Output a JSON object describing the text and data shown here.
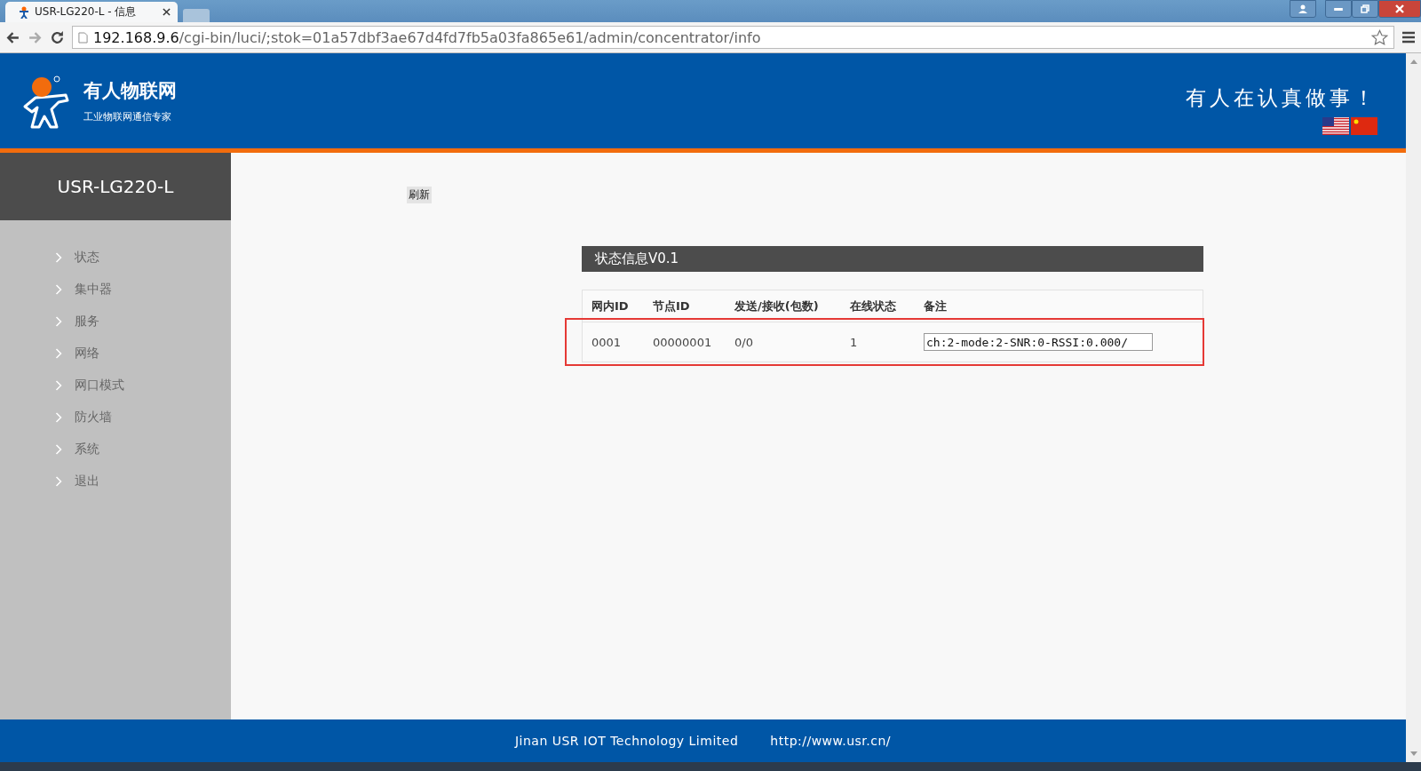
{
  "browser": {
    "tab_title": "USR-LG220-L - 信息",
    "url_host": "192.168.9.6",
    "url_path": "/cgi-bin/luci/;stok=01a57dbf3ae67d4fd7fb5a03fa865e61/admin/concentrator/info"
  },
  "header": {
    "brand": "有人物联网",
    "tagline": "工业物联网通信专家",
    "slogan": "有人在认真做事！"
  },
  "sidebar": {
    "title": "USR-LG220-L",
    "items": [
      {
        "label": "状态",
        "selected": false
      },
      {
        "label": "集中器",
        "selected": false
      },
      {
        "label": "服务",
        "selected": false
      },
      {
        "label": "网络",
        "selected": false
      },
      {
        "label": "网口模式",
        "selected": false
      },
      {
        "label": "防火墙",
        "selected": false
      },
      {
        "label": "系统",
        "selected": false
      },
      {
        "label": "退出",
        "selected": false
      }
    ]
  },
  "refresh_button": "刷新",
  "panel": {
    "title": "状态信息V0.1",
    "columns": [
      "网内ID",
      "节点ID",
      "发送/接收(包数)",
      "在线状态",
      "备注"
    ],
    "rows": [
      {
        "cells": [
          "0001",
          "00000001",
          "0/0",
          "1"
        ],
        "remark": "ch:2-mode:2-SNR:0-RSSI:0.000/",
        "highlighted": true
      }
    ]
  },
  "footer": {
    "company": "Jinan USR IOT Technology Limited",
    "link": "http://www.usr.cn/"
  }
}
